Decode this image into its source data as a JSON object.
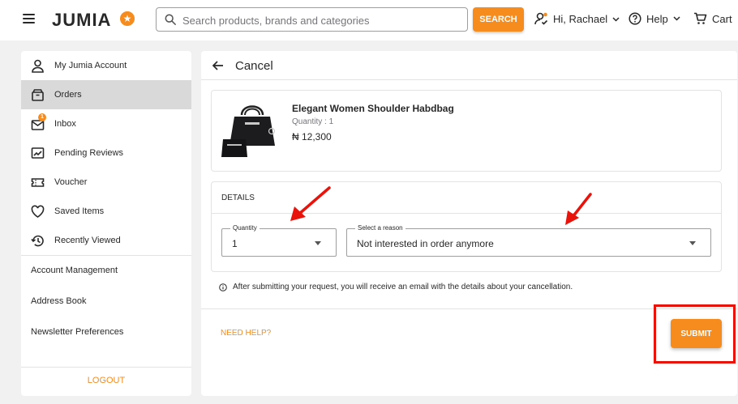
{
  "header": {
    "logo_text": "JUMIA",
    "search": {
      "placeholder": "Search products, brands and categories",
      "value": ""
    },
    "search_button": "SEARCH",
    "account_label": "Hi, Rachael",
    "help_label": "Help",
    "cart_label": "Cart",
    "accent_color": "#f68b1e"
  },
  "sidebar": {
    "items": [
      {
        "label": "My Jumia Account",
        "icon": "user-icon"
      },
      {
        "label": "Orders",
        "icon": "orders-icon",
        "active": true
      },
      {
        "label": "Inbox",
        "icon": "inbox-icon",
        "badge": "1"
      },
      {
        "label": "Pending Reviews",
        "icon": "reviews-icon"
      },
      {
        "label": "Voucher",
        "icon": "voucher-icon"
      },
      {
        "label": "Saved Items",
        "icon": "heart-icon"
      },
      {
        "label": "Recently Viewed",
        "icon": "history-icon"
      }
    ],
    "links": [
      "Account Management",
      "Address Book",
      "Newsletter Preferences"
    ],
    "logout": "LOGOUT"
  },
  "main": {
    "title": "Cancel",
    "product": {
      "name": "Elegant Women Shoulder Habdbag",
      "quantity": "Quantity : 1",
      "price": "₦ 12,300"
    },
    "details": {
      "title": "DETAILS",
      "quantity_label": "Quantity",
      "quantity_value": "1",
      "reason_label": "Select a reason",
      "reason_value": "Not interested in order anymore"
    },
    "info": "After submitting your request, you will receive an email with the details about your cancellation.",
    "need_help": "NEED HELP?",
    "submit": "SUBMIT"
  },
  "annotations": {
    "arrow_color": "#e8140c",
    "box_color": "#e8140c"
  }
}
